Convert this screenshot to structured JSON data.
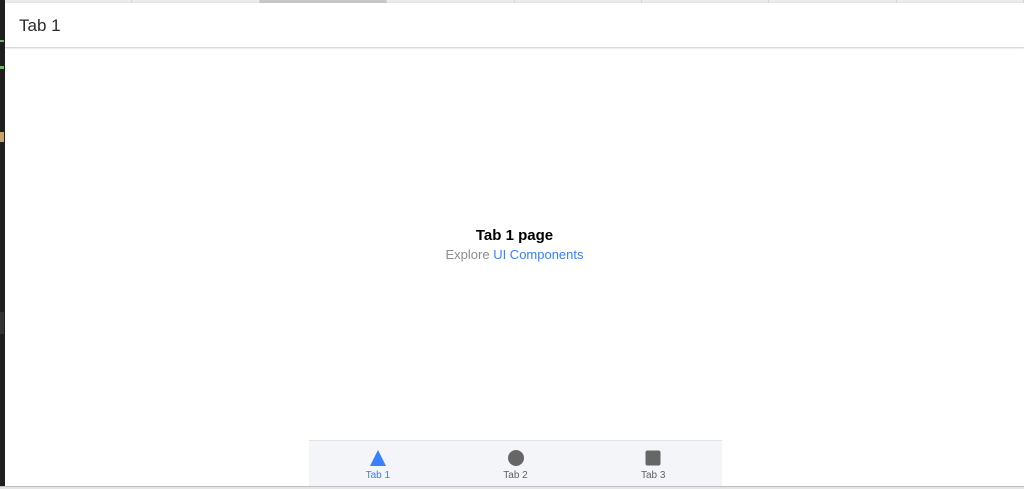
{
  "toolbar": {
    "title": "Tab 1"
  },
  "main": {
    "heading": "Tab 1 page",
    "explore_prefix": "Explore",
    "explore_link": "UI Components"
  },
  "tabs": [
    {
      "label": "Tab 1",
      "icon": "triangle-icon",
      "selected": true
    },
    {
      "label": "Tab 2",
      "icon": "ellipse-icon",
      "selected": false
    },
    {
      "label": "Tab 3",
      "icon": "square-icon",
      "selected": false
    }
  ],
  "colors": {
    "accent": "#3880ff",
    "icon_inactive": "#666666",
    "tab_bar_bg": "#f4f5f8"
  }
}
